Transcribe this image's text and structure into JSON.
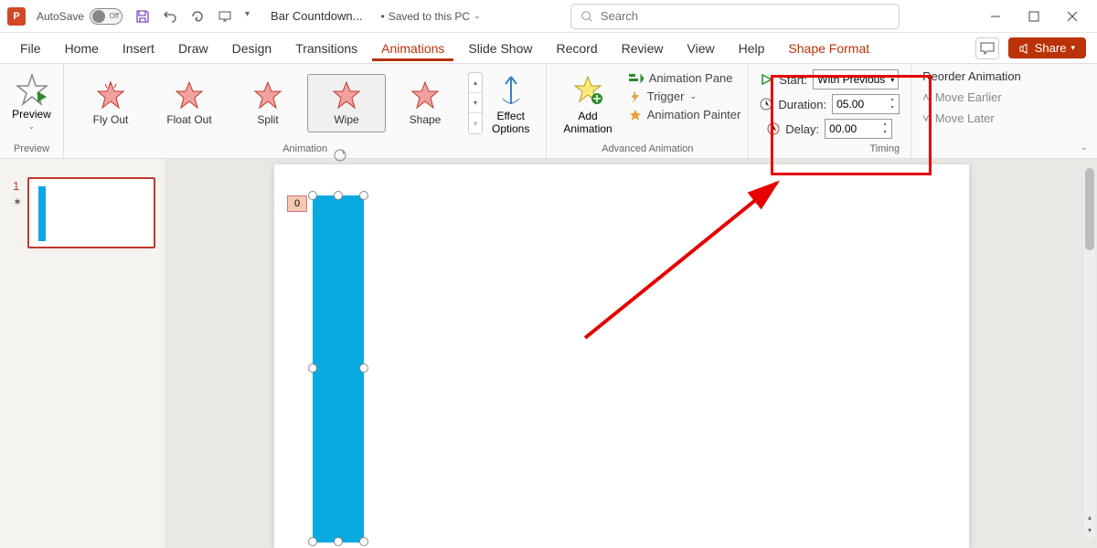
{
  "titlebar": {
    "autosave_label": "AutoSave",
    "autosave_state": "Off",
    "doc_title": "Bar Countdown...",
    "saved_status": "Saved to this PC",
    "search_placeholder": "Search"
  },
  "tabs": {
    "file": "File",
    "home": "Home",
    "insert": "Insert",
    "draw": "Draw",
    "design": "Design",
    "transitions": "Transitions",
    "animations": "Animations",
    "slide_show": "Slide Show",
    "record": "Record",
    "review": "Review",
    "view": "View",
    "help": "Help",
    "shape_format": "Shape Format",
    "share": "Share"
  },
  "ribbon": {
    "preview": {
      "label": "Preview",
      "group": "Preview"
    },
    "animation": {
      "group": "Animation",
      "items": [
        "Fly Out",
        "Float Out",
        "Split",
        "Wipe",
        "Shape"
      ],
      "selected": "Wipe",
      "effect_options": "Effect\nOptions"
    },
    "advanced": {
      "group": "Advanced Animation",
      "add": "Add\nAnimation",
      "pane": "Animation Pane",
      "trigger": "Trigger",
      "painter": "Animation Painter"
    },
    "timing": {
      "group": "Timing",
      "start_label": "Start:",
      "start_value": "With Previous",
      "duration_label": "Duration:",
      "duration_value": "05.00",
      "delay_label": "Delay:",
      "delay_value": "00.00"
    },
    "reorder": {
      "header": "Reorder Animation",
      "earlier": "Move Earlier",
      "later": "Move Later"
    }
  },
  "slide": {
    "number": "1",
    "anim_tag": "0"
  }
}
